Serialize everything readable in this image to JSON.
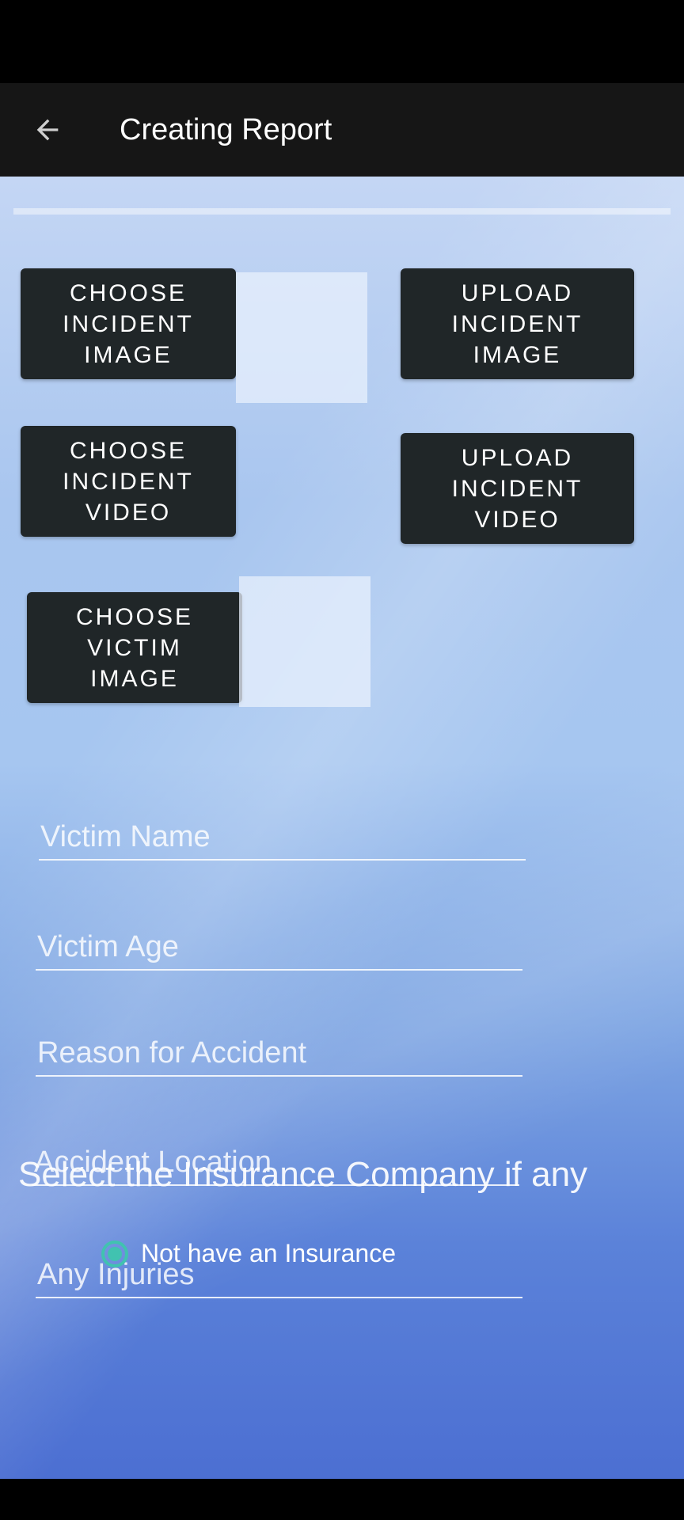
{
  "app_bar": {
    "title": "Creating Report",
    "back_icon": "arrow-left-icon"
  },
  "buttons": {
    "choose_incident_image": "CHOOSE\nINCIDENT\nIMAGE",
    "upload_incident_image": "UPLOAD\nINCIDENT\nIMAGE",
    "choose_incident_video": "CHOOSE\nINCIDENT\nVIDEO",
    "upload_incident_video": "UPLOAD\nINCIDENT\nVIDEO",
    "choose_victim_image": "CHOOSE\nVICTIM\nIMAGE"
  },
  "fields": {
    "victim_name": {
      "placeholder": "Victim Name",
      "value": ""
    },
    "victim_age": {
      "placeholder": "Victim Age",
      "value": ""
    },
    "reason": {
      "placeholder": "Reason for Accident",
      "value": ""
    },
    "location": {
      "placeholder": "Accident Location",
      "value": ""
    },
    "injuries": {
      "placeholder": "Any Injuries",
      "value": ""
    }
  },
  "insurance": {
    "label": "Select the Insurance Company if any",
    "options": [
      {
        "label": "Not have an Insurance",
        "selected": true
      }
    ]
  },
  "colors": {
    "app_bar": "#161616",
    "button_bg": "#202628",
    "radio_accent": "#41c2b0"
  }
}
